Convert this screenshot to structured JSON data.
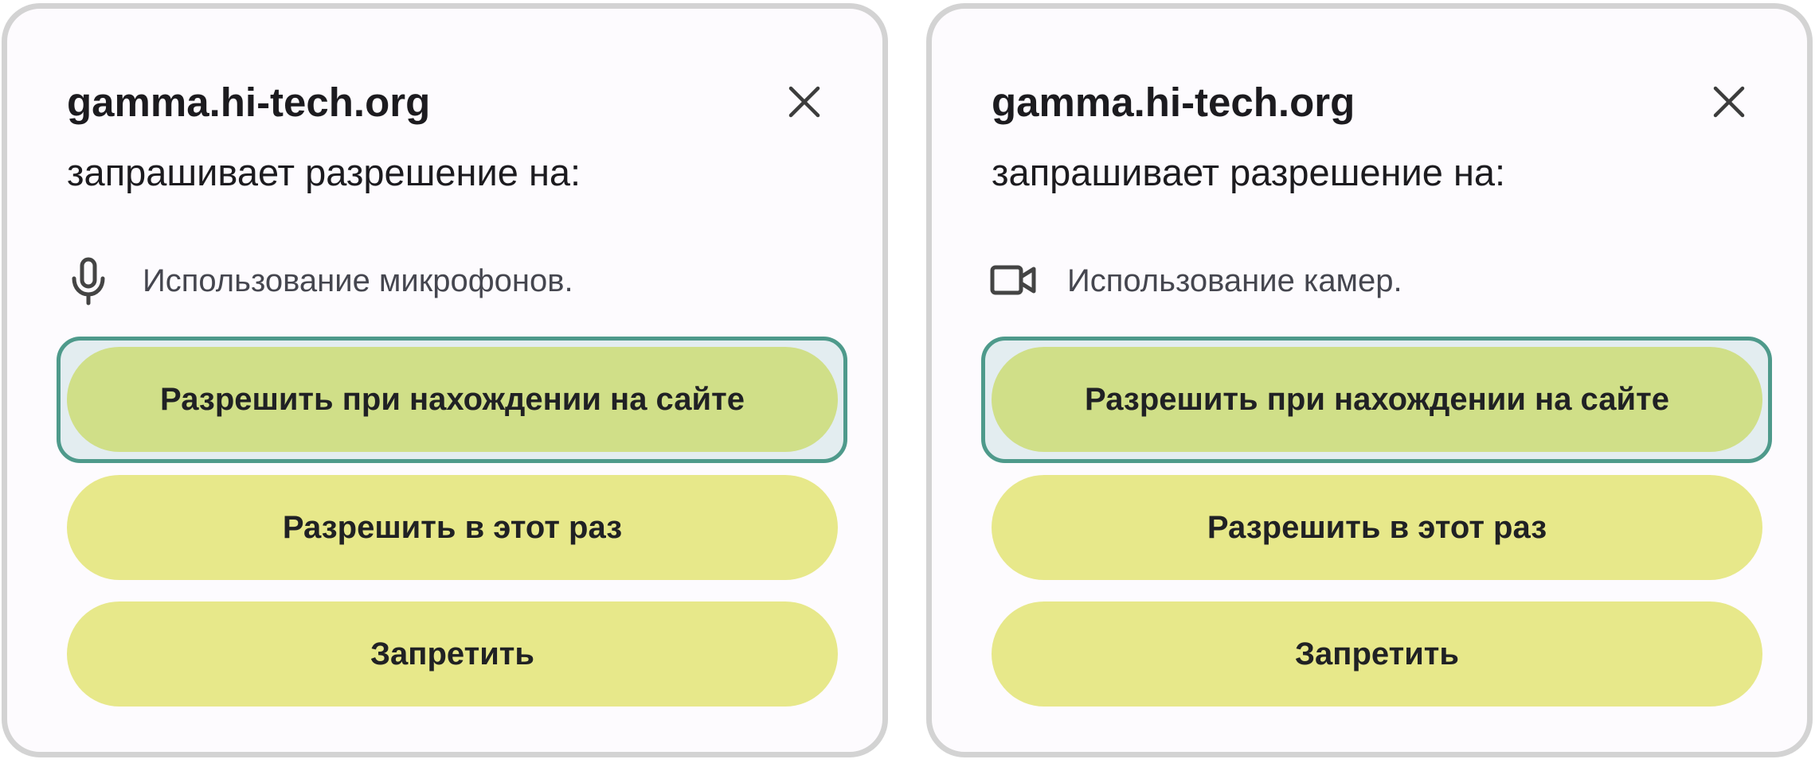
{
  "dialogs": [
    {
      "site": "gamma.hi-tech.org",
      "subtitle": "запрашивает разрешение на:",
      "permission_icon": "microphone-icon",
      "permission_text": "Использование микрофонов.",
      "close_icon": "close-icon",
      "buttons": {
        "allow_site": "Разрешить при нахождении на сайте",
        "allow_once": "Разрешить в этот раз",
        "deny": "Запретить"
      }
    },
    {
      "site": "gamma.hi-tech.org",
      "subtitle": "запрашивает разрешение на:",
      "permission_icon": "camera-icon",
      "permission_text": "Использование камер.",
      "close_icon": "close-icon",
      "buttons": {
        "allow_site": "Разрешить при нахождении на сайте",
        "allow_once": "Разрешить в этот раз",
        "deny": "Запретить"
      }
    }
  ],
  "colors": {
    "dialog_background": "#fdfbfe",
    "dialog_border": "#d3d3d3",
    "focused_button": "#d0df88",
    "button": "#e7e88a",
    "focus_ring": "#4e9a8b",
    "text": "#1c1b1f",
    "secondary_text": "#45464f"
  }
}
